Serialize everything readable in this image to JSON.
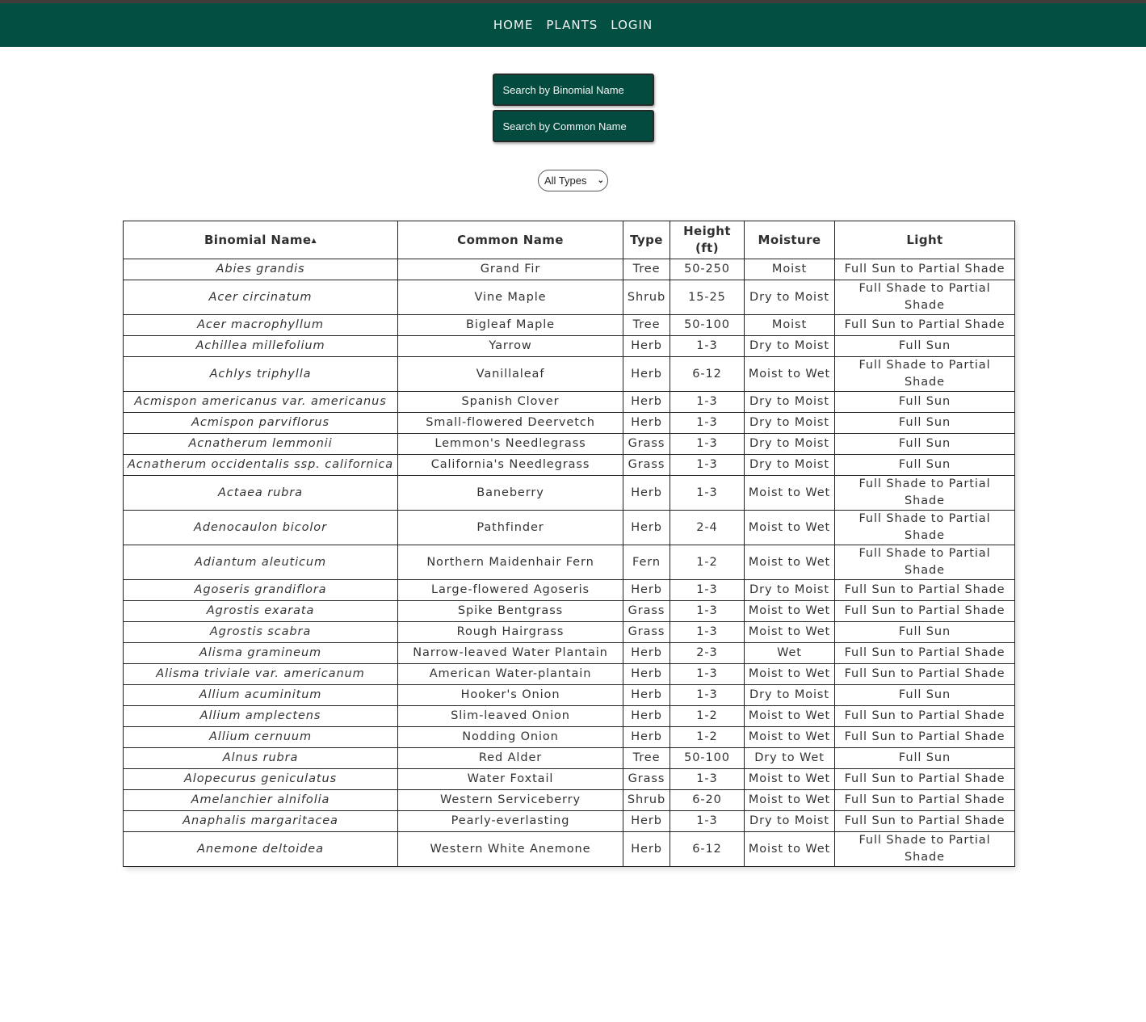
{
  "nav": {
    "items": [
      {
        "label": "HOME"
      },
      {
        "label": "PLANTS"
      },
      {
        "label": "LOGIN"
      }
    ]
  },
  "search": {
    "binomial_button": "Search by Binomial Name",
    "common_button": "Search by Common Name"
  },
  "filter": {
    "selected": "All Types",
    "chevron_icon": "⌄"
  },
  "colors": {
    "brand": "#034f42",
    "topbar": "#403c3c"
  },
  "table": {
    "headers": {
      "binomial": "Binomial Name",
      "sort_indicator": "▲",
      "common": "Common Name",
      "type": "Type",
      "height": "Height (ft)",
      "moisture": "Moisture",
      "light": "Light"
    },
    "rows": [
      {
        "binomial": "Abies grandis",
        "common": "Grand Fir",
        "type": "Tree",
        "height": "50-250",
        "moisture": "Moist",
        "light": "Full Sun to Partial Shade"
      },
      {
        "binomial": "Acer circinatum",
        "common": "Vine Maple",
        "type": "Shrub",
        "height": "15-25",
        "moisture": "Dry to Moist",
        "light": "Full Shade to Partial Shade"
      },
      {
        "binomial": "Acer macrophyllum",
        "common": "Bigleaf Maple",
        "type": "Tree",
        "height": "50-100",
        "moisture": "Moist",
        "light": "Full Sun to Partial Shade"
      },
      {
        "binomial": "Achillea millefolium",
        "common": "Yarrow",
        "type": "Herb",
        "height": "1-3",
        "moisture": "Dry to Moist",
        "light": "Full Sun"
      },
      {
        "binomial": "Achlys triphylla",
        "common": "Vanillaleaf",
        "type": "Herb",
        "height": "6-12",
        "moisture": "Moist to Wet",
        "light": "Full Shade to Partial Shade"
      },
      {
        "binomial": "Acmispon americanus var. americanus",
        "common": "Spanish Clover",
        "type": "Herb",
        "height": "1-3",
        "moisture": "Dry to Moist",
        "light": "Full Sun"
      },
      {
        "binomial": "Acmispon parviflorus",
        "common": "Small-flowered Deervetch",
        "type": "Herb",
        "height": "1-3",
        "moisture": "Dry to Moist",
        "light": "Full Sun"
      },
      {
        "binomial": "Acnatherum lemmonii",
        "common": "Lemmon's Needlegrass",
        "type": "Grass",
        "height": "1-3",
        "moisture": "Dry to Moist",
        "light": "Full Sun"
      },
      {
        "binomial": "Acnatherum occidentalis ssp. californica",
        "common": "California's Needlegrass",
        "type": "Grass",
        "height": "1-3",
        "moisture": "Dry to Moist",
        "light": "Full Sun"
      },
      {
        "binomial": "Actaea rubra",
        "common": "Baneberry",
        "type": "Herb",
        "height": "1-3",
        "moisture": "Moist to Wet",
        "light": "Full Shade to Partial Shade"
      },
      {
        "binomial": "Adenocaulon bicolor",
        "common": "Pathfinder",
        "type": "Herb",
        "height": "2-4",
        "moisture": "Moist to Wet",
        "light": "Full Shade to Partial Shade"
      },
      {
        "binomial": "Adiantum aleuticum",
        "common": "Northern Maidenhair Fern",
        "type": "Fern",
        "height": "1-2",
        "moisture": "Moist to Wet",
        "light": "Full Shade to Partial Shade"
      },
      {
        "binomial": "Agoseris grandiflora",
        "common": "Large-flowered Agoseris",
        "type": "Herb",
        "height": "1-3",
        "moisture": "Dry to Moist",
        "light": "Full Sun to Partial Shade"
      },
      {
        "binomial": "Agrostis exarata",
        "common": "Spike Bentgrass",
        "type": "Grass",
        "height": "1-3",
        "moisture": "Moist to Wet",
        "light": "Full Sun to Partial Shade"
      },
      {
        "binomial": "Agrostis scabra",
        "common": "Rough Hairgrass",
        "type": "Grass",
        "height": "1-3",
        "moisture": "Moist to Wet",
        "light": "Full Sun"
      },
      {
        "binomial": "Alisma gramineum",
        "common": "Narrow-leaved Water Plantain",
        "type": "Herb",
        "height": "2-3",
        "moisture": "Wet",
        "light": "Full Sun to Partial Shade"
      },
      {
        "binomial": "Alisma triviale var. americanum",
        "common": "American Water-plantain",
        "type": "Herb",
        "height": "1-3",
        "moisture": "Moist to Wet",
        "light": "Full Sun to Partial Shade"
      },
      {
        "binomial": "Allium acuminitum",
        "common": "Hooker's Onion",
        "type": "Herb",
        "height": "1-3",
        "moisture": "Dry to Moist",
        "light": "Full Sun"
      },
      {
        "binomial": "Allium amplectens",
        "common": "Slim-leaved Onion",
        "type": "Herb",
        "height": "1-2",
        "moisture": "Moist to Wet",
        "light": "Full Sun to Partial Shade"
      },
      {
        "binomial": "Allium cernuum",
        "common": "Nodding Onion",
        "type": "Herb",
        "height": "1-2",
        "moisture": "Moist to Wet",
        "light": "Full Sun to Partial Shade"
      },
      {
        "binomial": "Alnus rubra",
        "common": "Red Alder",
        "type": "Tree",
        "height": "50-100",
        "moisture": "Dry to Wet",
        "light": "Full Sun"
      },
      {
        "binomial": "Alopecurus geniculatus",
        "common": "Water Foxtail",
        "type": "Grass",
        "height": "1-3",
        "moisture": "Moist to Wet",
        "light": "Full Sun to Partial Shade"
      },
      {
        "binomial": "Amelanchier alnifolia",
        "common": "Western Serviceberry",
        "type": "Shrub",
        "height": "6-20",
        "moisture": "Moist to Wet",
        "light": "Full Sun to Partial Shade"
      },
      {
        "binomial": "Anaphalis margaritacea",
        "common": "Pearly-everlasting",
        "type": "Herb",
        "height": "1-3",
        "moisture": "Dry to Moist",
        "light": "Full Sun to Partial Shade"
      },
      {
        "binomial": "Anemone deltoidea",
        "common": "Western White Anemone",
        "type": "Herb",
        "height": "6-12",
        "moisture": "Moist to Wet",
        "light": "Full Shade to Partial Shade"
      }
    ]
  }
}
